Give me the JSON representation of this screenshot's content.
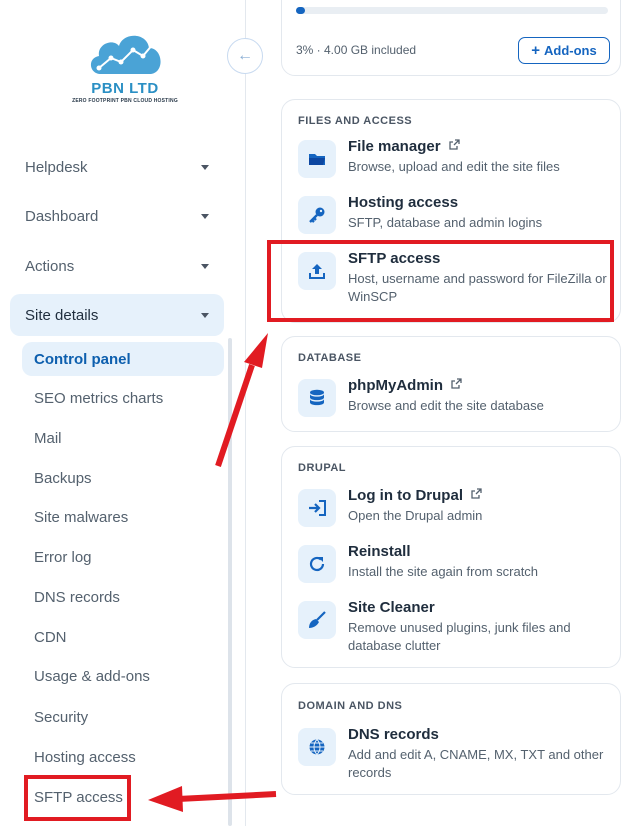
{
  "brand": {
    "name": "PBN LTD",
    "tagline": "ZERO FOOTPRINT PBN CLOUD HOSTING",
    "colors": {
      "cloud": "#4aa3d6",
      "accent": "#1565c0",
      "highlight": "#e11b22"
    }
  },
  "sidebar": {
    "collapse_icon": "arrow-left-icon",
    "items": [
      {
        "label": "Helpdesk"
      },
      {
        "label": "Dashboard"
      },
      {
        "label": "Actions"
      },
      {
        "label": "Site details"
      }
    ],
    "subitems": [
      {
        "label": "Control panel"
      },
      {
        "label": "SEO metrics charts"
      },
      {
        "label": "Mail"
      },
      {
        "label": "Backups"
      },
      {
        "label": "Site malwares"
      },
      {
        "label": "Error log"
      },
      {
        "label": "DNS records"
      },
      {
        "label": "CDN"
      },
      {
        "label": "Usage & add-ons"
      },
      {
        "label": "Security"
      },
      {
        "label": "Hosting access"
      },
      {
        "label": "SFTP access"
      }
    ]
  },
  "usage": {
    "progress": 0.03,
    "text": "3% · 4.00 GB included",
    "addons_label": "Add-ons"
  },
  "files": {
    "title": "FILES AND ACCESS",
    "items": [
      {
        "title": "File manager",
        "desc": "Browse, upload and edit the site files",
        "icon": "folder-icon"
      },
      {
        "title": "Hosting access",
        "desc": "SFTP, database and admin logins",
        "icon": "key-icon"
      },
      {
        "title": "SFTP access",
        "desc": "Host, username and password for FileZilla or WinSCP",
        "icon": "upload-icon"
      }
    ]
  },
  "database": {
    "title": "DATABASE",
    "items": [
      {
        "title": "phpMyAdmin",
        "desc": "Browse and edit the site database",
        "icon": "database-icon"
      }
    ]
  },
  "drupal": {
    "title": "DRUPAL",
    "items": [
      {
        "title": "Log in to Drupal",
        "desc": "Open the Drupal admin",
        "icon": "login-icon"
      },
      {
        "title": "Reinstall",
        "desc": "Install the site again from scratch",
        "icon": "refresh-icon"
      },
      {
        "title": "Site Cleaner",
        "desc": "Remove unused plugins, junk files and database clutter",
        "icon": "broom-icon"
      }
    ]
  },
  "dns": {
    "title": "DOMAIN AND DNS",
    "items": [
      {
        "title": "DNS records",
        "desc": "Add and edit A, CNAME, MX, TXT and other records",
        "icon": "globe-icon"
      }
    ]
  }
}
